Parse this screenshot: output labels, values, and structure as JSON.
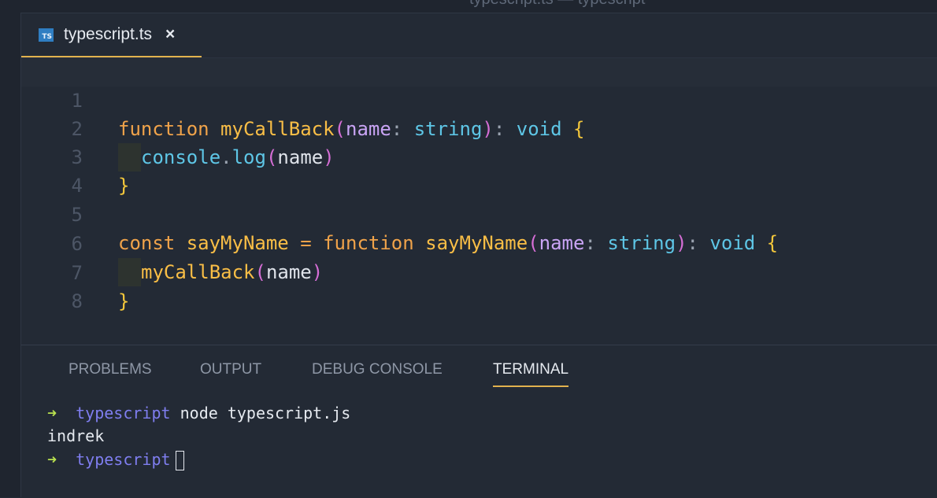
{
  "window": {
    "title_partial": "typescript.ts — typescript"
  },
  "tab": {
    "label": "typescript.ts",
    "icon": "TS",
    "close": "×"
  },
  "editor": {
    "lines": [
      {
        "number": "1"
      },
      {
        "number": "2"
      },
      {
        "number": "3"
      },
      {
        "number": "4"
      },
      {
        "number": "5"
      },
      {
        "number": "6"
      },
      {
        "number": "7"
      },
      {
        "number": "8"
      }
    ],
    "tokens": {
      "function": "function",
      "myCallBack": "myCallBack",
      "name": "name",
      "string": "string",
      "void": "void",
      "console": "console",
      "log": "log",
      "const": "const",
      "sayMyName": "sayMyName",
      "equals": "=",
      "lparen": "(",
      "rparen": ")",
      "colon": ":",
      "dot": ".",
      "lbrace": "{",
      "rbrace": "}"
    }
  },
  "panel": {
    "tabs": [
      "PROBLEMS",
      "OUTPUT",
      "DEBUG CONSOLE",
      "TERMINAL"
    ],
    "active_tab": "TERMINAL"
  },
  "terminal": {
    "prompt_arrow": "➜",
    "cwd": "typescript",
    "command": "node typescript.js",
    "output": "indrek"
  },
  "colors": {
    "accent": "#e2b24e",
    "background": "#232a35",
    "prompt_arrow": "#b8e04f",
    "cwd": "#7f7ef0"
  }
}
